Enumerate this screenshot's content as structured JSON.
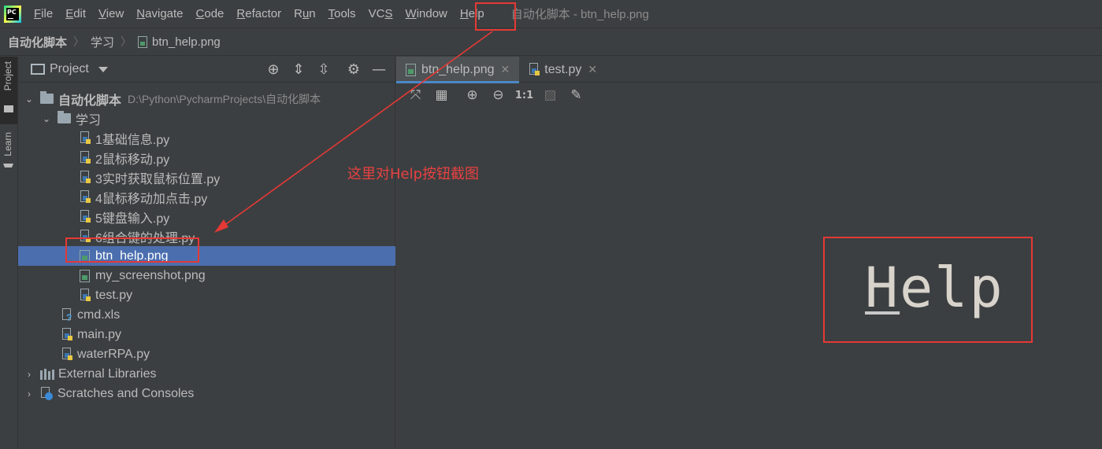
{
  "menubar": {
    "logo_text": "PC",
    "items": [
      {
        "pre": "",
        "ul": "F",
        "post": "ile"
      },
      {
        "pre": "",
        "ul": "E",
        "post": "dit"
      },
      {
        "pre": "",
        "ul": "V",
        "post": "iew"
      },
      {
        "pre": "",
        "ul": "N",
        "post": "avigate"
      },
      {
        "pre": "",
        "ul": "C",
        "post": "ode"
      },
      {
        "pre": "",
        "ul": "R",
        "post": "efactor"
      },
      {
        "pre": "R",
        "ul": "u",
        "post": "n"
      },
      {
        "pre": "",
        "ul": "T",
        "post": "ools"
      },
      {
        "pre": "VC",
        "ul": "S",
        "post": ""
      },
      {
        "pre": "",
        "ul": "W",
        "post": "indow"
      },
      {
        "pre": "",
        "ul": "H",
        "post": "elp"
      }
    ],
    "window_title": "自动化脚本 - btn_help.png"
  },
  "breadcrumb": {
    "items": [
      "自动化脚本",
      "学习",
      "btn_help.png"
    ]
  },
  "toolstrip": {
    "project_label": "Project",
    "learn_label": "Learn"
  },
  "project_panel": {
    "title": "Project",
    "root": {
      "name": "自动化脚本",
      "path": "D:\\Python\\PycharmProjects\\自动化脚本"
    },
    "subfolder": "学习",
    "files_in_sub": [
      {
        "name": "1基础信息.py",
        "type": "py"
      },
      {
        "name": "2鼠标移动.py",
        "type": "py"
      },
      {
        "name": "3实时获取鼠标位置.py",
        "type": "py"
      },
      {
        "name": "4鼠标移动加点击.py",
        "type": "py"
      },
      {
        "name": "5键盘输入.py",
        "type": "py"
      },
      {
        "name": "6组合键的处理.py",
        "type": "py"
      },
      {
        "name": "btn_help.png",
        "type": "png",
        "selected": true
      },
      {
        "name": "my_screenshot.png",
        "type": "png"
      },
      {
        "name": "test.py",
        "type": "py"
      }
    ],
    "root_files": [
      {
        "name": "cmd.xls",
        "type": "xls"
      },
      {
        "name": "main.py",
        "type": "py"
      },
      {
        "name": "waterRPA.py",
        "type": "py"
      }
    ],
    "external_libraries": "External Libraries",
    "scratches": "Scratches and Consoles"
  },
  "editor": {
    "tabs": [
      {
        "label": "btn_help.png",
        "active": true
      },
      {
        "label": "test.py",
        "active": false
      }
    ],
    "image_toolbar": {
      "actual_size_label": "1:1"
    },
    "preview_text": {
      "first": "H",
      "rest": "elp"
    }
  },
  "annotation": {
    "text": "这里对Help按钮截图",
    "color": "#e84141"
  },
  "colors": {
    "selection": "#4b6eaf",
    "accent_tab": "#4a88c7",
    "annotation_red": "#e53935"
  }
}
